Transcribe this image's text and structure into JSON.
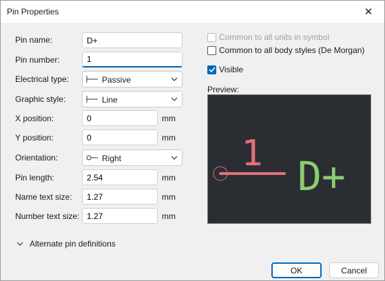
{
  "window": {
    "title": "Pin Properties",
    "close_glyph": "✕"
  },
  "form": {
    "pin_name": {
      "label": "Pin name:",
      "value": "D+"
    },
    "pin_number": {
      "label": "Pin number:",
      "value": "1"
    },
    "electrical_type": {
      "label": "Electrical type:",
      "value": "Passive"
    },
    "graphic_style": {
      "label": "Graphic style:",
      "value": "Line"
    },
    "x_position": {
      "label": "X position:",
      "value": "0",
      "unit": "mm"
    },
    "y_position": {
      "label": "Y position:",
      "value": "0",
      "unit": "mm"
    },
    "orientation": {
      "label": "Orientation:",
      "value": "Right"
    },
    "pin_length": {
      "label": "Pin length:",
      "value": "2.54",
      "unit": "mm"
    },
    "name_text_size": {
      "label": "Name text size:",
      "value": "1.27",
      "unit": "mm"
    },
    "number_text_size": {
      "label": "Number text size:",
      "value": "1.27",
      "unit": "mm"
    }
  },
  "options": {
    "common_units": {
      "label": "Common to all units in symbol",
      "checked": false,
      "enabled": false
    },
    "common_body_styles": {
      "label": "Common to all body styles (De Morgan)",
      "checked": false,
      "enabled": true
    },
    "visible": {
      "label": "Visible",
      "checked": true,
      "enabled": true
    }
  },
  "preview": {
    "label": "Preview:",
    "pin_number": "1",
    "pin_name": "D+",
    "colors": {
      "background": "#2a2e33",
      "pin": "#e0707a",
      "name": "#8ccb72"
    }
  },
  "alternate": {
    "label": "Alternate pin definitions"
  },
  "buttons": {
    "ok": "OK",
    "cancel": "Cancel"
  },
  "accent_color": "#0067c0"
}
